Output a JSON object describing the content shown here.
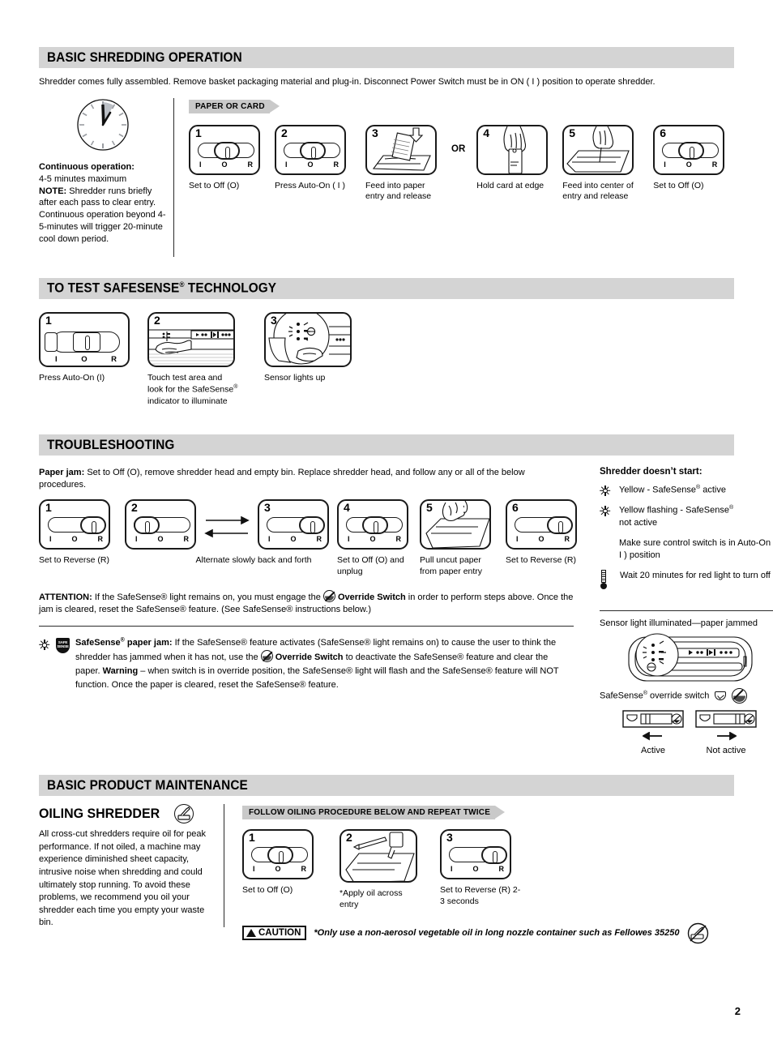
{
  "page_number": "2",
  "sections": {
    "shredding": {
      "title": "BASIC SHREDDING OPERATION",
      "intro": "Shredder comes fully assembled. Remove basket packaging material and plug-in. Disconnect Power Switch must be in ON ( I ) position to operate shredder.",
      "note": {
        "heading": "Continuous operation:",
        "line1": "4-5 minutes maximum",
        "note_label": "NOTE:",
        "note_text": "Shredder runs briefly after each pass to clear entry. Continuous operation beyond 4-5-minutes will trigger 20-minute cool  down period."
      },
      "banner": "PAPER OR CARD",
      "or_label": "OR",
      "steps": [
        {
          "num": "1",
          "type": "switch",
          "position": "O",
          "caption": "Set to Off (O)"
        },
        {
          "num": "2",
          "type": "switch",
          "position": "O",
          "caption": "Press Auto-On ( I )"
        },
        {
          "num": "3",
          "type": "illustration",
          "art": "feed-paper",
          "caption": "Feed into paper entry and release"
        },
        {
          "num": "4",
          "type": "illustration",
          "art": "hold-card",
          "caption": "Hold card at edge"
        },
        {
          "num": "5",
          "type": "illustration",
          "art": "feed-card",
          "caption": "Feed into center of entry and release"
        },
        {
          "num": "6",
          "type": "switch",
          "position": "O",
          "caption": "Set to Off (O)"
        }
      ],
      "switch_labels": [
        "I",
        "O",
        "R"
      ]
    },
    "safesense_test": {
      "title": "TO TEST SAFESENSE® TECHNOLOGY",
      "steps": [
        {
          "num": "1",
          "type": "switch-wide",
          "position": "I",
          "caption": "Press Auto-On (I)"
        },
        {
          "num": "2",
          "type": "illustration",
          "art": "touch-test",
          "caption": "Touch test area and look for the SafeSense® indicator to illuminate"
        },
        {
          "num": "3",
          "type": "illustration",
          "art": "sensor-light",
          "caption": "Sensor lights up"
        }
      ]
    },
    "troubleshooting": {
      "title": "TROUBLESHOOTING",
      "paper_jam_label": "Paper jam:",
      "paper_jam_text": "Set to Off (O), remove shredder head and empty bin. Replace shredder head, and follow any or all of the below procedures.",
      "steps": [
        {
          "num": "1",
          "type": "switch",
          "position": "R",
          "caption": "Set to Reverse (R)"
        },
        {
          "num": "2",
          "type": "switch",
          "position": "I",
          "caption": ""
        },
        {
          "num": "3",
          "type": "switch",
          "position": "R",
          "caption": "Alternate slowly back and forth"
        },
        {
          "num": "4",
          "type": "switch",
          "position": "O",
          "caption": "Set to Off (O) and unplug"
        },
        {
          "num": "5",
          "type": "illustration",
          "art": "pull-paper",
          "caption": "Pull uncut paper from paper entry"
        },
        {
          "num": "6",
          "type": "switch",
          "position": "R",
          "caption": "Set to Reverse (R)"
        }
      ],
      "attention_label": "ATTENTION:",
      "attention_text_a": " If the SafeSense® light remains on, you must engage the ",
      "attention_bold": "Override Switch",
      "attention_text_b": " in order to perform steps above. Once the jam is cleared, reset the SafeSense® feature. (See SafeSense® instructions below.)",
      "safesense_jam_label": "SafeSense® paper jam:",
      "safesense_jam_a": " If the SafeSense® feature activates (SafeSense® light remains on) to cause the user to think the shredder has jammed when it has not, use the ",
      "safesense_jam_bold": "Override Switch",
      "safesense_jam_b": " to deactivate the SafeSense® feature and clear the paper. ",
      "warning_word": "Warning",
      "safesense_jam_c": " – when switch is in override position, the SafeSense® light will flash and the SafeSense® feature will NOT function. Once the paper is cleared, reset the SafeSense® feature.",
      "shield_text": "SAFE SENSE",
      "sidebar": {
        "heading": "Shredder doesn’t start:",
        "items": [
          {
            "icon": "sun-icon",
            "text": "Yellow - SafeSense® active"
          },
          {
            "icon": "sun-icon",
            "text": "Yellow flashing - SafeSense® not active"
          },
          {
            "icon": "none",
            "text": "Make sure control switch is in Auto-On ( I ) position"
          },
          {
            "icon": "thermometer-icon",
            "text": "Wait 20 minutes for red light to turn off"
          }
        ]
      },
      "sensor_panel": {
        "caption": "Sensor light illuminated—paper jammed",
        "override_label": "SafeSense® override switch",
        "active_label": "Active",
        "not_active_label": "Not active"
      }
    },
    "maintenance": {
      "title": "BASIC PRODUCT MAINTENANCE",
      "oiling_title": "OILING SHREDDER",
      "oiling_text": "All cross-cut shredders require oil for peak performance. If not oiled, a machine may experience diminished sheet capacity, intrusive noise when shredding and could ultimately stop running. To avoid these problems, we recommend you oil your shredder each time you empty your waste bin.",
      "banner": "FOLLOW OILING PROCEDURE BELOW AND REPEAT TWICE",
      "steps": [
        {
          "num": "1",
          "type": "switch",
          "position": "O",
          "caption": "Set to Off (O)"
        },
        {
          "num": "2",
          "type": "illustration",
          "art": "apply-oil",
          "caption": "*Apply oil across entry"
        },
        {
          "num": "3",
          "type": "switch",
          "position": "R",
          "caption": "Set to Reverse (R) 2-3 seconds"
        }
      ],
      "caution_label": "CAUTION",
      "caution_text": "*Only use a non-aerosol vegetable oil in long nozzle container such as Fellowes 35250"
    }
  },
  "colors": {
    "header_bar": "#d4d4d4",
    "banner": "#c9c9c9",
    "ink": "#000000"
  }
}
